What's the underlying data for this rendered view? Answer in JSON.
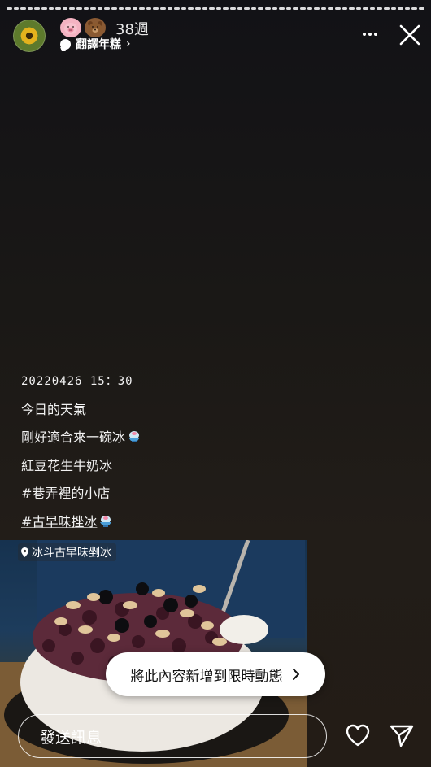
{
  "story": {
    "progress_segments": 60,
    "header": {
      "avatar_icon": "sunflower-avatar",
      "badges": [
        "pig-emoji",
        "bear-emoji"
      ],
      "elapsed": "38週",
      "translate_label": "翻譯年糕",
      "translate_chevron": "›"
    },
    "caption": {
      "date": "20220426 15：30",
      "line1": "今日的天氣",
      "line2": "剛好適合來一碗冰",
      "line3": "紅豆花生牛奶冰",
      "hashtag1": "#巷弄裡的小店",
      "hashtag2": "#古早味挫冰"
    },
    "location": "冰斗古早味剉冰",
    "add_to_story": "將此內容新增到限時動態",
    "message_placeholder": "發送訊息"
  },
  "colors": {
    "background_top": "#121216",
    "background_bottom": "#231c16",
    "pill_background": "#ffffff"
  }
}
